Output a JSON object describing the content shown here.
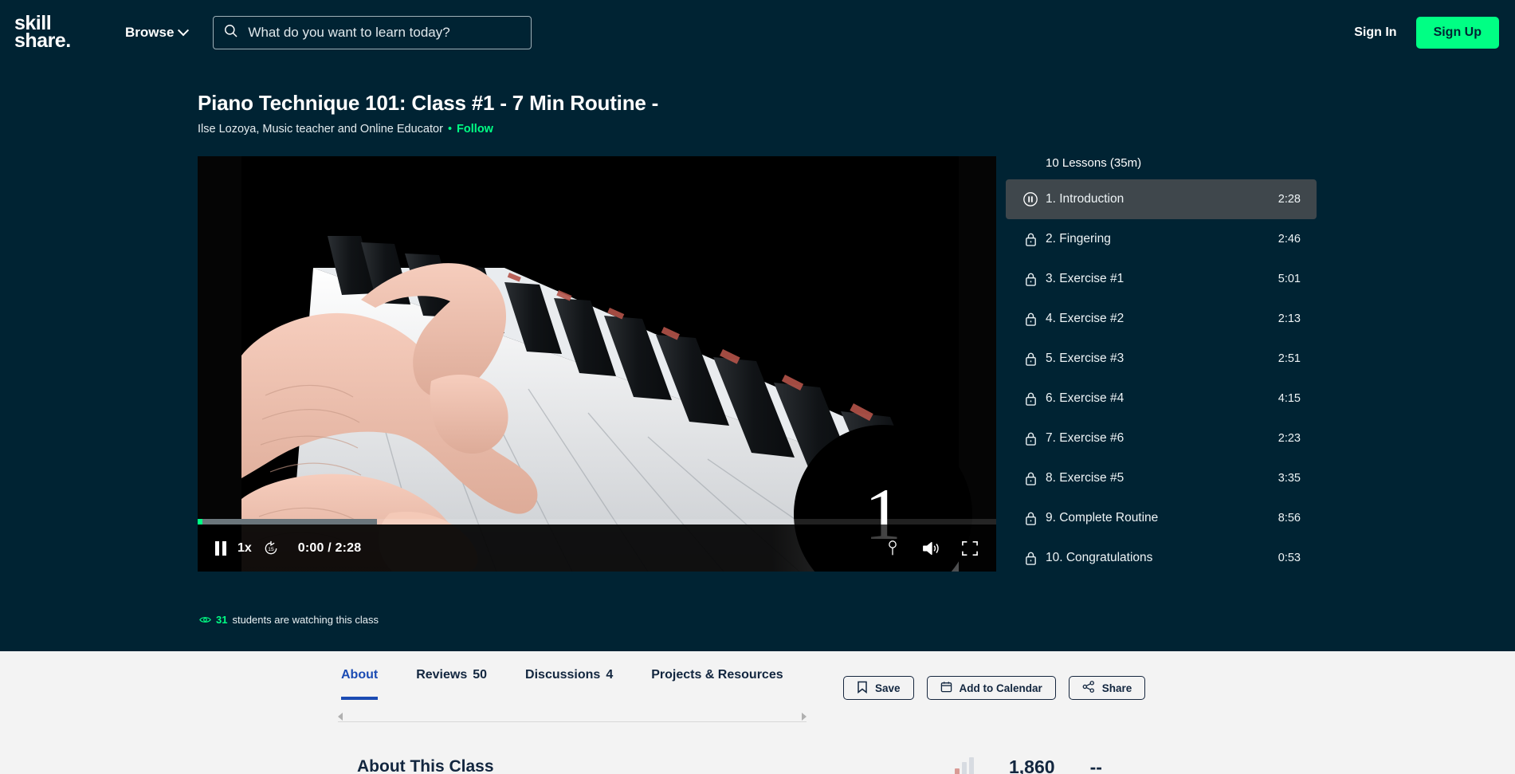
{
  "header": {
    "logo_line1": "skill",
    "logo_line2": "share.",
    "browse_label": "Browse",
    "search_placeholder": "What do you want to learn today?",
    "search_value": "",
    "sign_in_label": "Sign In",
    "sign_up_label": "Sign Up",
    "accent_green": "#00ff84",
    "background": "#002333"
  },
  "class": {
    "title": "Piano Technique 101: Class #1 - 7 Min Routine -",
    "teacher": "Ilse Lozoya, Music teacher and Online Educator",
    "separator": "•",
    "follow_label": "Follow"
  },
  "player": {
    "badge_number": "1",
    "speed_label": "1x",
    "rewind_label": "15",
    "current_time": "0:00",
    "duration": "2:28",
    "time_display": "0:00 / 2:28",
    "played_percent": 0.6,
    "buffered_percent": 22.5,
    "watching_count": "31",
    "watching_text": "students are watching this class"
  },
  "lessons": {
    "summary": "10 Lessons (35m)",
    "items": [
      {
        "label": "1. Introduction",
        "time": "2:28",
        "state": "playing"
      },
      {
        "label": "2. Fingering",
        "time": "2:46",
        "state": "locked"
      },
      {
        "label": "3. Exercise #1",
        "time": "5:01",
        "state": "locked"
      },
      {
        "label": "4. Exercise #2",
        "time": "2:13",
        "state": "locked"
      },
      {
        "label": "5. Exercise #3",
        "time": "2:51",
        "state": "locked"
      },
      {
        "label": "6. Exercise #4",
        "time": "4:15",
        "state": "locked"
      },
      {
        "label": "7. Exercise #6",
        "time": "2:23",
        "state": "locked"
      },
      {
        "label": "8. Exercise #5",
        "time": "3:35",
        "state": "locked"
      },
      {
        "label": "9. Complete Routine",
        "time": "8:56",
        "state": "locked"
      },
      {
        "label": "10. Congratulations",
        "time": "0:53",
        "state": "locked"
      }
    ]
  },
  "tabs": [
    {
      "label": "About",
      "count": "",
      "active": true
    },
    {
      "label": "Reviews",
      "count": "50",
      "active": false
    },
    {
      "label": "Discussions",
      "count": "4",
      "active": false
    },
    {
      "label": "Projects & Resources",
      "count": "",
      "active": false
    }
  ],
  "actions": [
    {
      "label": "Save",
      "icon": "bookmark-icon"
    },
    {
      "label": "Add to Calendar",
      "icon": "calendar-icon"
    },
    {
      "label": "Share",
      "icon": "share-icon"
    }
  ],
  "about": {
    "heading": "About This Class",
    "students_count": "1,860",
    "secondary_stat": "--"
  }
}
